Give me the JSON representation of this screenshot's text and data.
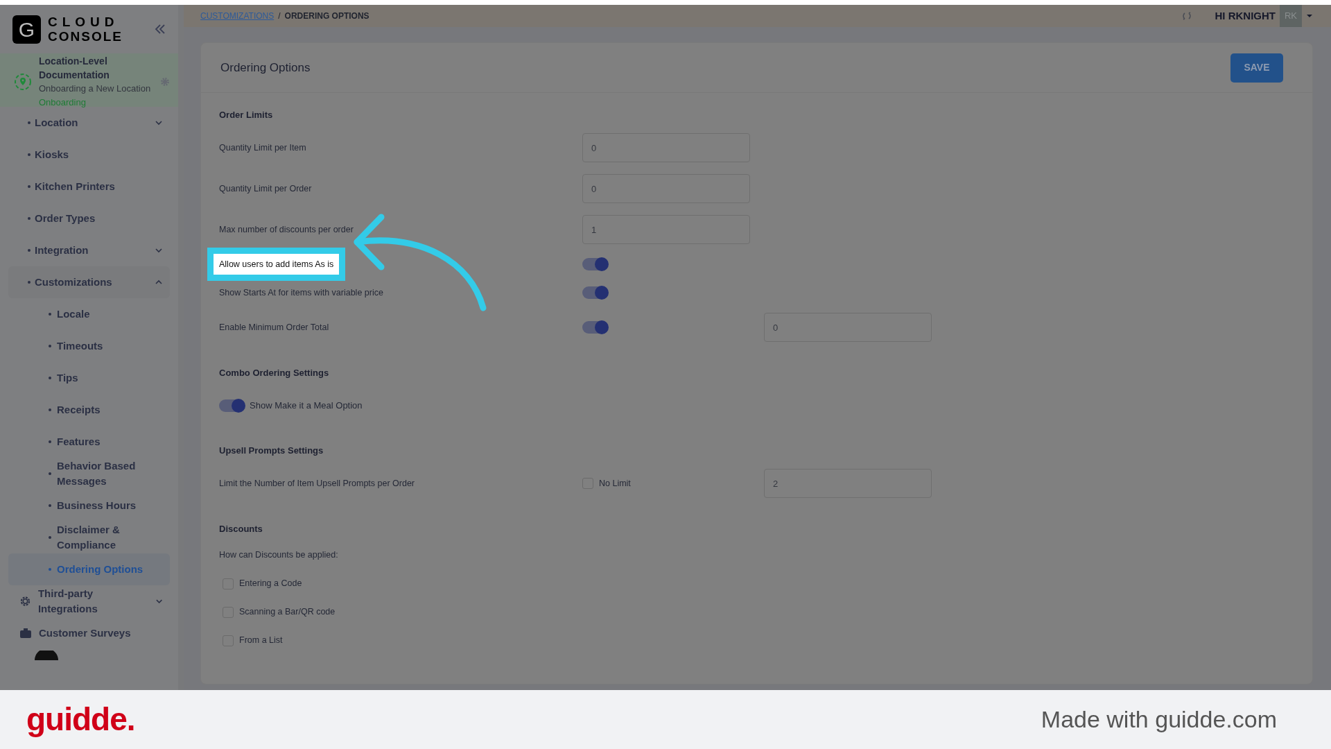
{
  "app": {
    "logo_letter": "G",
    "logo_line1": "CLOUD",
    "logo_line2": "CONSOLE"
  },
  "location": {
    "title": "Location-Level Documentation",
    "subtitle": "Onboarding a New Location",
    "status": "Onboarding"
  },
  "sidebar": {
    "items": [
      {
        "kind": "bullet",
        "label": "Location",
        "expanded": false,
        "selected": false
      },
      {
        "kind": "bullet",
        "label": "Kiosks",
        "selected": false
      },
      {
        "kind": "bullet",
        "label": "Kitchen Printers",
        "selected": false
      },
      {
        "kind": "bullet",
        "label": "Order Types",
        "selected": false
      },
      {
        "kind": "bullet",
        "label": "Integration",
        "expanded": false,
        "selected": false
      },
      {
        "kind": "bullet",
        "label": "Customizations",
        "expanded": true,
        "selected": false,
        "children": [
          {
            "label": "Locale",
            "selected": false
          },
          {
            "label": "Timeouts",
            "selected": false
          },
          {
            "label": "Tips",
            "selected": false
          },
          {
            "label": "Receipts",
            "selected": false
          },
          {
            "label": "Features",
            "selected": false
          },
          {
            "label": "Behavior Based Messages",
            "selected": false
          },
          {
            "label": "Business Hours",
            "selected": false
          },
          {
            "label": "Disclaimer & Compliance",
            "selected": false
          },
          {
            "label": "Ordering Options",
            "selected": true
          }
        ]
      },
      {
        "kind": "gear",
        "label": "Third-party Integrations",
        "expanded": false,
        "selected": false
      },
      {
        "kind": "briefcase",
        "label": "Customer Surveys",
        "selected": false
      }
    ]
  },
  "breadcrumb": {
    "items": [
      {
        "kind": "link",
        "label": "CUSTOMIZATIONS"
      },
      {
        "kind": "current",
        "label": "ORDERING OPTIONS"
      }
    ],
    "separator": "/"
  },
  "user": {
    "greeting": "HI RKNIGHT",
    "initials": "RK"
  },
  "page": {
    "title": "Ordering Options",
    "save": "SAVE",
    "sections": [
      {
        "heading": "Order Limits",
        "rows": [
          {
            "kind": "input",
            "label": "Quantity Limit per Item",
            "value": "0",
            "highlighted": false
          },
          {
            "kind": "input",
            "label": "Quantity Limit per Order",
            "value": "0",
            "highlighted": false
          },
          {
            "kind": "input",
            "label": "Max number of discounts per order",
            "value": "1",
            "highlighted": false
          },
          {
            "kind": "toggle",
            "label": "Allow users to add items As is",
            "on": true,
            "highlighted": true
          },
          {
            "kind": "toggle",
            "label": "Show Starts At for items with variable price",
            "on": true,
            "highlighted": false
          },
          {
            "kind": "toggle_input",
            "label": "Enable Minimum Order Total",
            "on": true,
            "value": "0",
            "highlighted": false
          }
        ]
      },
      {
        "heading": "Combo Ordering Settings",
        "rows": [
          {
            "kind": "toggle_inline",
            "label": "Show Make it a Meal Option",
            "on": true,
            "highlighted": false
          }
        ]
      },
      {
        "heading": "Upsell Prompts Settings",
        "rows": [
          {
            "kind": "checkbox_input",
            "label": "Limit the Number of Item Upsell Prompts per Order",
            "check_label": "No Limit",
            "checked": false,
            "value": "2",
            "highlighted": false
          }
        ]
      },
      {
        "heading": "Discounts",
        "rows": [
          {
            "kind": "text",
            "label": "How can Discounts be applied:",
            "highlighted": false
          },
          {
            "kind": "checkbox",
            "label": "Entering a Code",
            "checked": false,
            "highlighted": false
          },
          {
            "kind": "checkbox",
            "label": "Scanning a Bar/QR code",
            "checked": false,
            "highlighted": false
          },
          {
            "kind": "checkbox",
            "label": "From a List",
            "checked": false,
            "highlighted": false
          }
        ]
      }
    ]
  },
  "footer": {
    "brand": "guidde.",
    "tagline": "Made with guidde.com"
  }
}
